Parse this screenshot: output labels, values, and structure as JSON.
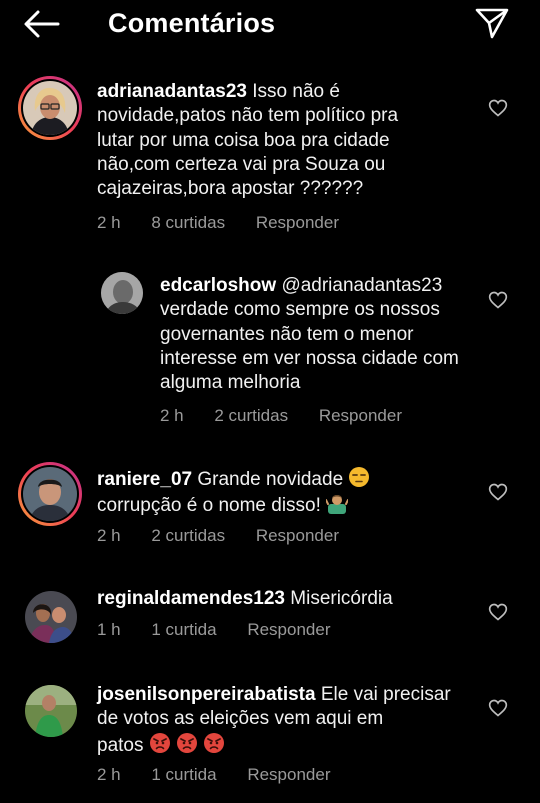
{
  "header": {
    "title": "Comentários",
    "back_icon": "arrow-left-icon",
    "send_icon": "paper-plane-icon"
  },
  "comments": [
    {
      "username": "adrianadantas23",
      "text": "Isso não é novidade,patos não tem político pra lutar por uma coisa boa pra cidade não,com certeza vai pra Souza ou cajazeiras,bora apostar ??????",
      "time": "2 h",
      "likes": "8 curtidas",
      "reply": "Responder"
    },
    {
      "username": "edcarloshow",
      "text": "@adrianadantas23 verdade como sempre os nossos governantes não tem o menor interesse em ver nossa cidade com alguma melhoria",
      "time": "2 h",
      "likes": "2 curtidas",
      "reply": "Responder"
    },
    {
      "username": "raniere_07",
      "text_line1": "Grande novidade",
      "text_line2": "corrupção é o nome disso!",
      "time": "2 h",
      "likes": "2 curtidas",
      "reply": "Responder"
    },
    {
      "username": "reginaldamendes123",
      "text": "Misericórdia",
      "time": "1 h",
      "likes": "1 curtida",
      "reply": "Responder"
    },
    {
      "username": "josenilsonpereirabatista",
      "text_line1": "Ele vai precisar de votos as eleições vem aqui em",
      "text_line2": "patos",
      "time": "2 h",
      "likes": "1 curtida",
      "reply": "Responder"
    }
  ],
  "colors": {
    "background": "#000000",
    "meta_text": "#9a9a9a",
    "story_ring": "#ee3f55"
  }
}
